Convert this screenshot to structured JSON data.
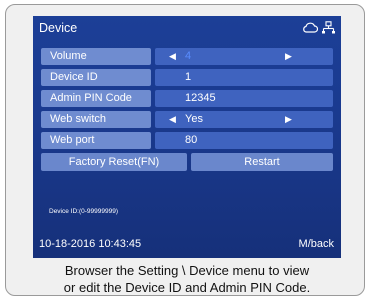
{
  "header": {
    "title": "Device"
  },
  "rows": [
    {
      "label": "Volume",
      "value": "4",
      "has_arrows": true
    },
    {
      "label": "Device ID",
      "value": "1",
      "has_arrows": false
    },
    {
      "label": "Admin PIN Code",
      "value": "12345",
      "has_arrows": false
    },
    {
      "label": "Web switch",
      "value": "Yes",
      "has_arrows": true
    },
    {
      "label": "Web port",
      "value": "80",
      "has_arrows": false
    }
  ],
  "buttons": {
    "factory_reset": "Factory Reset(FN)",
    "restart": "Restart"
  },
  "hint": "Device ID:(0-99999999)",
  "footer": {
    "datetime": "10-18-2016 10:43:45",
    "back": "M/back"
  },
  "caption": {
    "line1": "Browser the Setting \\ Device menu to view",
    "line2": "or edit the Device ID and Admin PIN Code."
  },
  "icons": {
    "cloud": "cloud-icon",
    "network": "network-icon",
    "left": "arrow-left-icon",
    "right": "arrow-right-icon"
  },
  "colors": {
    "screen_bg": "#1c3f97",
    "label_bg": "#6f8cd0",
    "value_bg": "#3f63bf",
    "volume_value": "#5a8cff"
  }
}
